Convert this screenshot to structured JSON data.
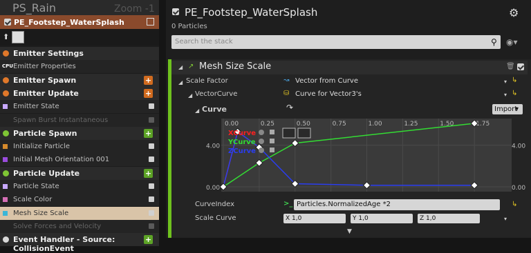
{
  "graph": {
    "title": "PS_Rain",
    "zoom": "Zoom -1"
  },
  "emitter": {
    "name": "PE_Footstep_WaterSplash"
  },
  "stack": [
    {
      "type": "hdr",
      "label": "Emitter Settings",
      "color": "#e0782a"
    },
    {
      "type": "item",
      "label": "Emitter Properties",
      "badge": "CPU"
    },
    {
      "type": "hdr",
      "label": "Emitter Spawn",
      "color": "#e0782a",
      "plus": "#d16b1f"
    },
    {
      "type": "hdr",
      "label": "Emitter Update",
      "color": "#e0782a",
      "plus": "#d16b1f"
    },
    {
      "type": "item",
      "label": "Emitter State",
      "dot": "#c8a8ff",
      "check": true
    },
    {
      "type": "item",
      "label": "Spawn Burst Instantaneous",
      "dim": true,
      "check": false
    },
    {
      "type": "hdr",
      "label": "Particle Spawn",
      "color": "#7fc535",
      "plus": "#5da326"
    },
    {
      "type": "item",
      "label": "Initialize Particle",
      "dot": "#d58a2c",
      "check": true
    },
    {
      "type": "item",
      "label": "Initial Mesh Orientation 001",
      "dot": "#9a4cdd",
      "check": true
    },
    {
      "type": "hdr",
      "label": "Particle Update",
      "color": "#7fc535",
      "plus": "#5da326"
    },
    {
      "type": "item",
      "label": "Particle State",
      "dot": "#c8a8ff",
      "check": true
    },
    {
      "type": "item",
      "label": "Scale Color",
      "dot": "#d56fb6",
      "check": true
    },
    {
      "type": "item",
      "label": "Mesh Size Scale",
      "dot": "#3ab6d8",
      "check": true,
      "sel": true
    },
    {
      "type": "item",
      "label": "Solve Forces and Velocity",
      "dim": true,
      "check": false
    },
    {
      "type": "hdr",
      "label": "Event Handler - Source: CollisionEvent",
      "color": "#d9d9d9",
      "plus": "#5da326"
    }
  ],
  "panel": {
    "title": "PE_Footstep_WaterSplash",
    "particles": "0 Particles",
    "search_placeholder": "Search the stack",
    "module_title": "Mesh Size Scale"
  },
  "props": {
    "scale_factor_label": "Scale Factor",
    "scale_factor_value": "Vector from Curve",
    "vector_curve_label": "VectorCurve",
    "vector_curve_value": "Curve for Vector3's",
    "curve_label": "Curve",
    "import_label": "Import",
    "curve_index_label": "CurveIndex",
    "curve_index_value": "Particles.NormalizedAge *2",
    "scale_curve_label": "Scale Curve",
    "scale_x": "X 1,0",
    "scale_y": "Y 1,0",
    "scale_z": "Z 1,0"
  },
  "chart_data": {
    "type": "line",
    "x_ticks": [
      "0.00",
      "0.25",
      "0.50",
      "0.75",
      "1.00",
      "1.25",
      "1.50",
      "1.75"
    ],
    "y_ticks": [
      "4.00",
      "0.00"
    ],
    "xlim": [
      0,
      2
    ],
    "ylim": [
      0,
      6.7
    ],
    "series": [
      {
        "name": "XCurve",
        "color": "#ff2020",
        "x": [
          0.0,
          0.1,
          0.25
        ],
        "y": [
          0.0,
          5.3,
          3.8
        ]
      },
      {
        "name": "YCurve",
        "color": "#33dd33",
        "x": [
          0.0,
          0.25,
          0.5,
          1.75
        ],
        "y": [
          0.0,
          2.3,
          4.2,
          6.1
        ]
      },
      {
        "name": "ZCurve",
        "color": "#2a3df0",
        "x": [
          0.0,
          0.1,
          0.25,
          0.5,
          1.0,
          1.75
        ],
        "y": [
          0.0,
          5.3,
          3.8,
          0.3,
          0.15,
          0.15
        ]
      }
    ]
  }
}
